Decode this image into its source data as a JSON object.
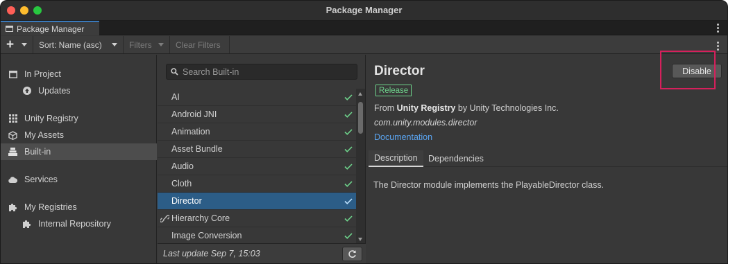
{
  "window": {
    "title": "Package Manager"
  },
  "tab": {
    "label": "Package Manager"
  },
  "toolbar": {
    "sort_label": "Sort: Name (asc)",
    "filters_label": "Filters",
    "clear_filters_label": "Clear Filters"
  },
  "sidebar": {
    "items": [
      {
        "label": "In Project",
        "icon": "window-icon"
      },
      {
        "label": "Updates",
        "icon": "arrow-up-circle-icon"
      },
      {
        "label": "Unity Registry",
        "icon": "grid-icon"
      },
      {
        "label": "My Assets",
        "icon": "cube-icon"
      },
      {
        "label": "Built-in",
        "icon": "stack-icon"
      },
      {
        "label": "Services",
        "icon": "cloud-icon"
      },
      {
        "label": "My Registries",
        "icon": "puzzle-icon"
      },
      {
        "label": "Internal Repository",
        "icon": "puzzle-icon"
      }
    ]
  },
  "search": {
    "placeholder": "Search Built-in"
  },
  "packages": [
    {
      "name": "AI"
    },
    {
      "name": "Android JNI"
    },
    {
      "name": "Animation"
    },
    {
      "name": "Asset Bundle"
    },
    {
      "name": "Audio"
    },
    {
      "name": "Cloth"
    },
    {
      "name": "Director"
    },
    {
      "name": "Hierarchy Core"
    },
    {
      "name": "Image Conversion"
    }
  ],
  "list_footer": {
    "last_update": "Last update Sep 7, 15:03"
  },
  "detail": {
    "title": "Director",
    "disable_label": "Disable",
    "badge": "Release",
    "from_prefix": "From ",
    "registry": "Unity Registry",
    "by_author": " by Unity Technologies Inc.",
    "package_id": "com.unity.modules.director",
    "documentation_label": "Documentation",
    "tabs": [
      {
        "label": "Description"
      },
      {
        "label": "Dependencies"
      }
    ],
    "description": "The Director module implements the PlayableDirector class."
  },
  "colors": {
    "accent_selected": "#2c5d87",
    "check_green": "#6fd68d",
    "link_blue": "#5aa4f0",
    "highlight_red": "#d6205c"
  }
}
